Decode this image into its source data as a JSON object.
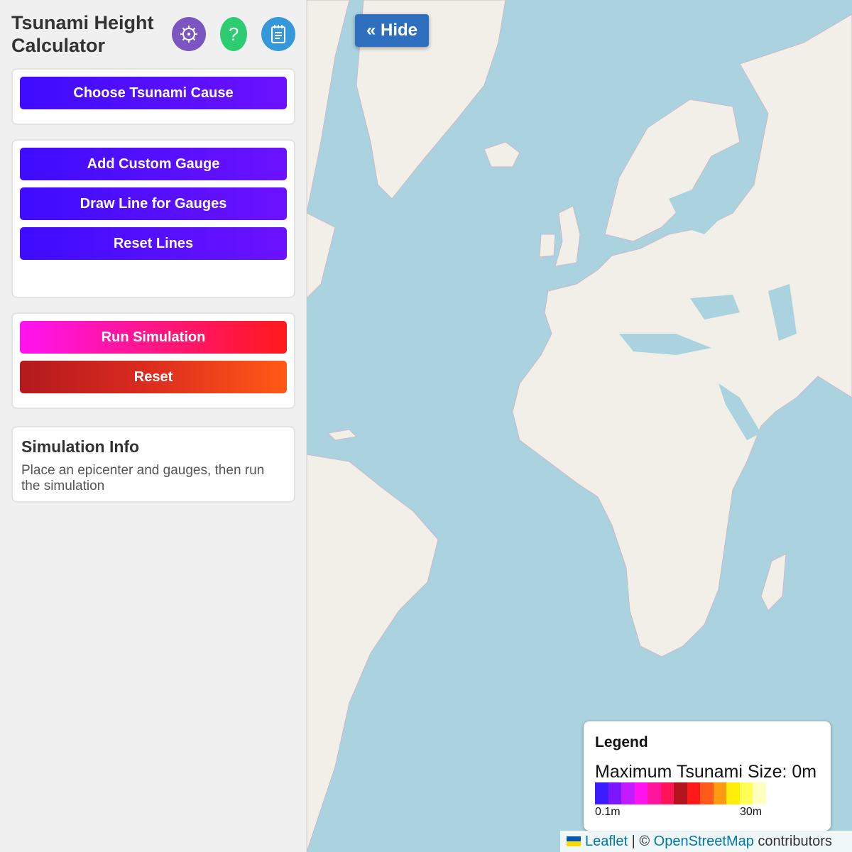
{
  "app": {
    "title": "Tsunami Height Calculator"
  },
  "header_icons": [
    {
      "name": "settings-gear-icon",
      "color": "#7b55c0"
    },
    {
      "name": "help-question-icon",
      "glyph": "?",
      "color": "#2ecc71"
    },
    {
      "name": "notepad-icon",
      "color": "#3498db"
    }
  ],
  "cause_panel": {
    "choose_cause_label": "Choose Tsunami Cause"
  },
  "gauge_panel": {
    "add_gauge_label": "Add Custom Gauge",
    "draw_line_label": "Draw Line for Gauges",
    "reset_lines_label": "Reset Lines"
  },
  "sim_panel": {
    "run_label": "Run Simulation",
    "reset_label": "Reset"
  },
  "info": {
    "title": "Simulation Info",
    "text": "Place an epicenter and gauges, then run the simulation"
  },
  "map": {
    "hide_label": "« Hide",
    "legend": {
      "title": "Legend",
      "max_size": "Maximum Tsunami Size: 0m",
      "min_label": "0.1m",
      "max_label": "30m",
      "colors": [
        "#3a1cff",
        "#7b17ff",
        "#c21bff",
        "#ff14f0",
        "#ff149e",
        "#ff1457",
        "#b3151e",
        "#ff1a1a",
        "#ff5a1a",
        "#ff9a14",
        "#ffee0a",
        "#ffff55",
        "#ffffbf"
      ]
    },
    "attribution": {
      "leaflet": "Leaflet",
      "separator": " | © ",
      "osm": "OpenStreetMap",
      "contributors": " contributors"
    }
  }
}
